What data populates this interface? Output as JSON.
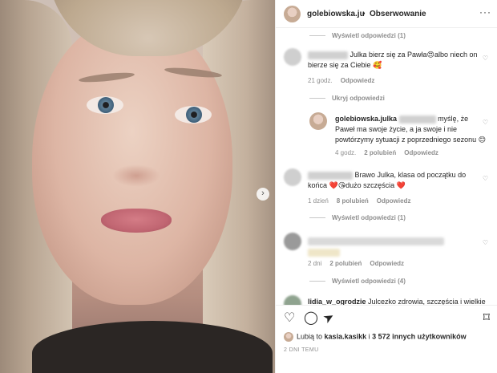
{
  "header": {
    "username": "golebiowska.ju",
    "separator": "•",
    "follow_label": "Obserwowanie",
    "more_label": "···"
  },
  "photo": {
    "next_label": "›"
  },
  "comments": {
    "view_replies_1": "Wyświetl odpowiedzi (1)",
    "c1_text": "Julka bierz się za Pawła😍albo niech on bierze się za Ciebie 🥰",
    "c1_time": "21 godz.",
    "c1_reply": "Odpowiedz",
    "hide_replies": "Ukryj odpowiedzi",
    "r1_user": "golebiowska.julka",
    "r1_text": "myślę, że Paweł ma swoje życie, a ja swoje i nie powtórzymy sytuacji z poprzedniego sezonu 😊",
    "r1_time": "4 godz.",
    "r1_likes": "2 polubień",
    "r1_reply": "Odpowiedz",
    "c2_text": "Brawo Julka, klasa od początku do końca ❤️😘dużo szczęścia ❤️",
    "c2_time": "1 dzień",
    "c2_likes": "8 polubień",
    "c2_reply": "Odpowiedz",
    "view_replies_2": "Wyświetl odpowiedzi (1)",
    "c3_time": "2 dni",
    "c3_likes": "2 polubień",
    "c3_reply": "Odpowiedz",
    "view_replies_3": "Wyświetl odpowiedzi (4)",
    "c4_user": "lidia_w_ogrodzie",
    "c4_text": "Julcezko zdrowia, szczęścia i wielkiej"
  },
  "actions": {
    "heart_icon": "♡",
    "comment_icon": "◯",
    "share_icon": "➤",
    "save_icon": "⌑",
    "likes_prefix": "Lubią to",
    "likes_user": "kasia.kasikk",
    "likes_mid": "i",
    "likes_count": "3 572 innych użytkowników",
    "date": "2 DNI TEMU"
  }
}
